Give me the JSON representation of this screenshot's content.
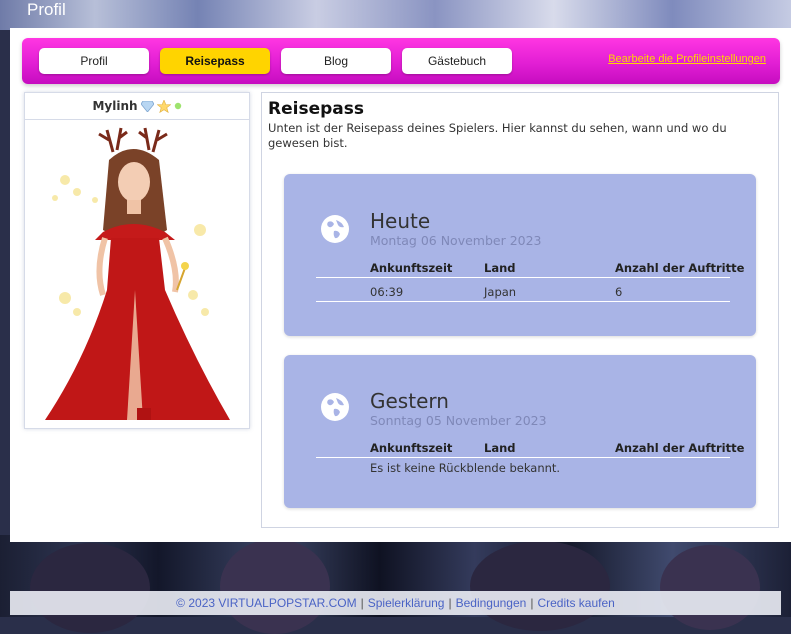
{
  "page": {
    "title": "Profil"
  },
  "nav": {
    "tabs": [
      {
        "label": "Profil"
      },
      {
        "label": "Reisepass"
      },
      {
        "label": "Blog"
      },
      {
        "label": "Gästebuch"
      }
    ],
    "edit_link": "Bearbeite die Profileinstellungen"
  },
  "avatar": {
    "name": "Mylinh"
  },
  "passport": {
    "heading": "Reisepass",
    "description": "Unten ist der Reisepass deines Spielers. Hier kannst du sehen, wann und wo du gewesen bist.",
    "columns": [
      "Ankunftszeit",
      "Land",
      "Anzahl der Auftritte"
    ],
    "days": [
      {
        "title": "Heute",
        "date": "Montag 06 November 2023",
        "rows": [
          {
            "time": "06:39",
            "country": "Japan",
            "count": "6"
          }
        ]
      },
      {
        "title": "Gestern",
        "date": "Sonntag 05 November 2023",
        "empty_message": "Es ist keine Rückblende bekannt."
      }
    ]
  },
  "footer": {
    "copyright": "© 2023 VIRTUALPOPSTAR.COM",
    "links": [
      "Spielerklärung",
      "Bedingungen",
      "Credits kaufen"
    ]
  },
  "colors": {
    "nav_pink": "#e21fd4",
    "active_tab": "#ffd400",
    "card_blue": "#a9b4e6",
    "link_blue": "#4a63c5"
  },
  "icons": [
    "diamond-icon",
    "star-icon",
    "online-dot-icon",
    "globe-icon"
  ]
}
